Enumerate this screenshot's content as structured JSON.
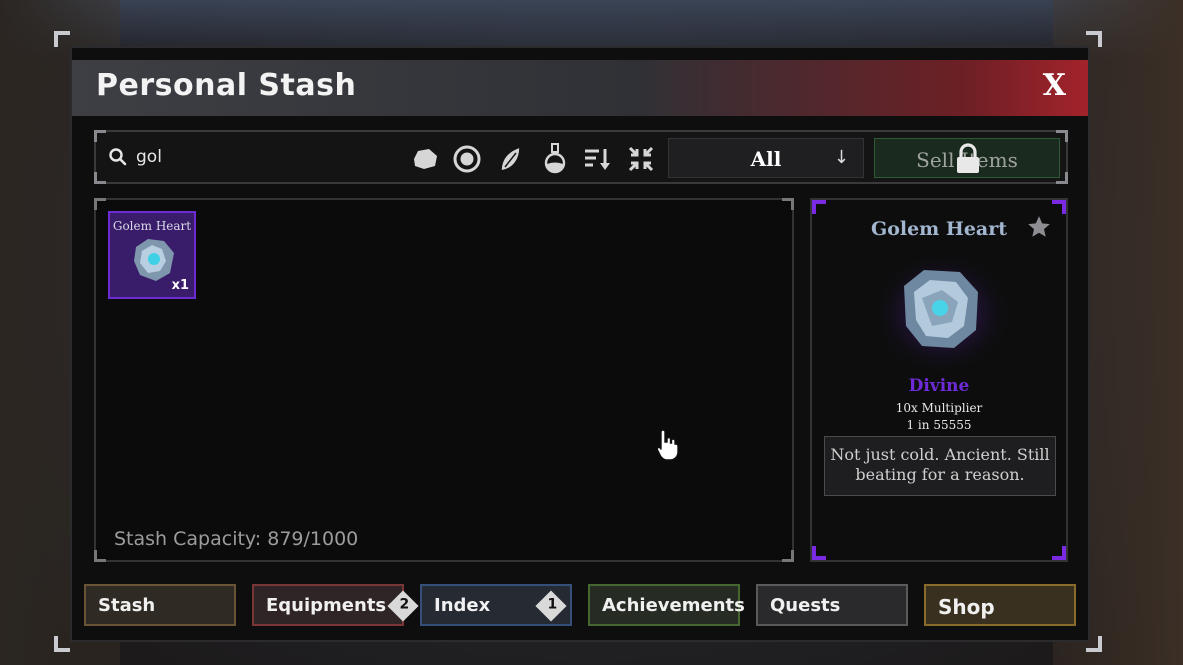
{
  "window": {
    "title": "Personal Stash",
    "close_label": "X"
  },
  "toolbar": {
    "search_value": "gol",
    "filter_value": "All",
    "filter_chevron": "↓",
    "sell_label": "Sell Items",
    "icons": [
      "search-icon",
      "ore-icon",
      "coin-icon",
      "leaf-icon",
      "potion-icon",
      "sort-icon",
      "collapse-icon",
      "chevron-down-icon",
      "lock-icon"
    ]
  },
  "stash": {
    "items": [
      {
        "name": "Golem Heart",
        "quantity": "x1",
        "rarity_color": "#6d2bd6"
      }
    ],
    "capacity_text": "Stash Capacity: 879/1000"
  },
  "detail": {
    "title": "Golem Heart",
    "rarity": "Divine",
    "multiplier": "10x Multiplier",
    "odds": "1 in 55555",
    "description": "Not just cold. Ancient. Still beating for a reason.",
    "rarity_color": "#6e2ad6"
  },
  "tabs": [
    {
      "label": "Stash",
      "color": "#8a6a3a"
    },
    {
      "label": "Equipments",
      "badge": "2",
      "color": "#b43a3a"
    },
    {
      "label": "Index",
      "badge": "1",
      "color": "#3a6aa8"
    },
    {
      "label": "Achievements",
      "color": "#5a8a3a"
    },
    {
      "label": "Quests",
      "color": "#888888"
    },
    {
      "label": "Shop",
      "color": "#b8902e"
    }
  ]
}
